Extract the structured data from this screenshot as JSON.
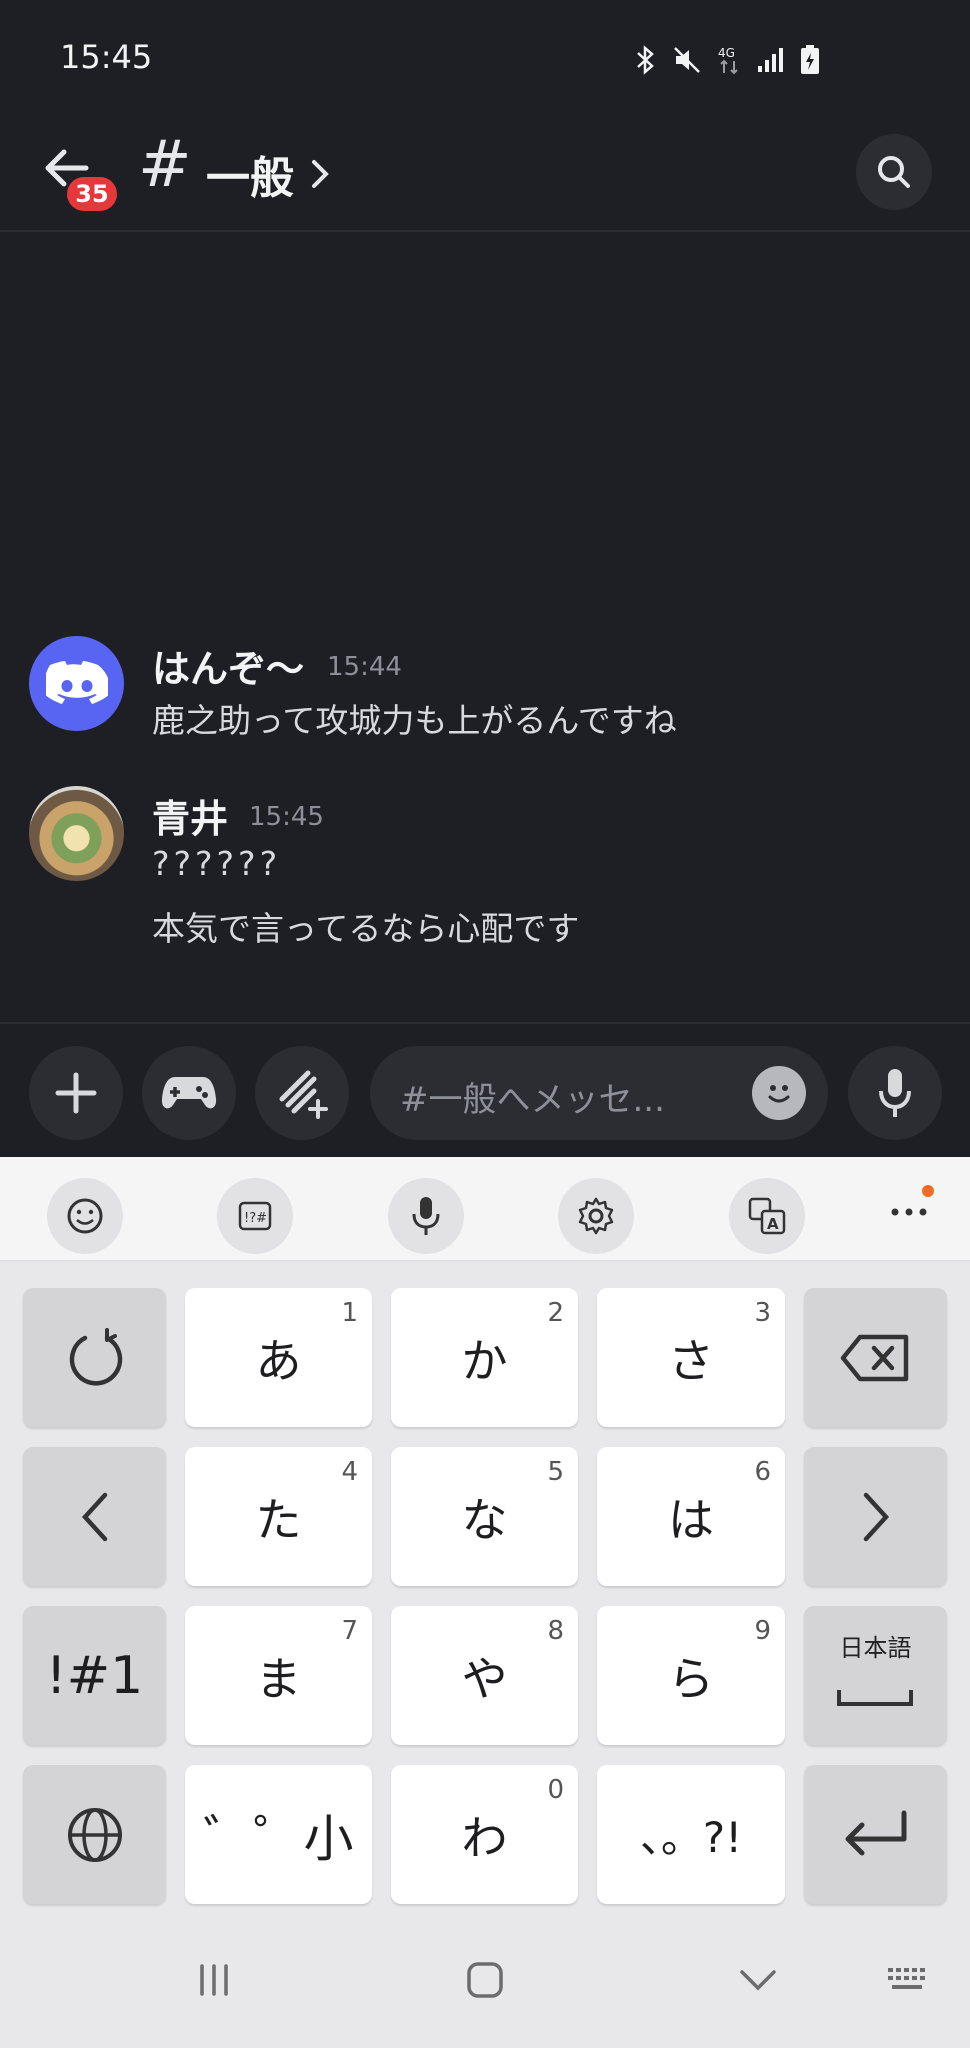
{
  "status_bar": {
    "time": "15:45",
    "icons": [
      "bluetooth-icon",
      "mute-icon",
      "4g-icon",
      "signal-icon",
      "battery-icon"
    ]
  },
  "header": {
    "unread_badge": "35",
    "hash": "#",
    "channel_name": "一般",
    "chevron": "›"
  },
  "messages": [
    {
      "author": "はんぞ〜",
      "time": "15:44",
      "lines": [
        "鹿之助って攻城力も上がるんですね"
      ],
      "avatar": "discord-logo"
    },
    {
      "author": "青井",
      "time": "15:45",
      "lines": [
        "??????",
        "本気で言ってるなら心配です"
      ],
      "avatar": "food-photo"
    }
  ],
  "composer": {
    "placeholder": "#一般へメッセ..."
  },
  "keyboard": {
    "toolbar_icons": [
      "emoji-icon",
      "symbols-icon",
      "voice-input-icon",
      "settings-icon",
      "translate-icon",
      "more-icon"
    ],
    "rows": [
      [
        {
          "label": "↺",
          "num": ""
        },
        {
          "label": "あ",
          "num": "1"
        },
        {
          "label": "か",
          "num": "2"
        },
        {
          "label": "さ",
          "num": "3"
        },
        {
          "label": "⌫",
          "num": ""
        }
      ],
      [
        {
          "label": "<",
          "num": ""
        },
        {
          "label": "た",
          "num": "4"
        },
        {
          "label": "な",
          "num": "5"
        },
        {
          "label": "は",
          "num": "6"
        },
        {
          "label": ">",
          "num": ""
        }
      ],
      [
        {
          "label": "!#1",
          "num": ""
        },
        {
          "label": "ま",
          "num": "7"
        },
        {
          "label": "や",
          "num": "8"
        },
        {
          "label": "ら",
          "num": "9"
        },
        {
          "label": "日本語",
          "num": ""
        }
      ],
      [
        {
          "label": "🌐",
          "num": ""
        },
        {
          "label": "゛゜小",
          "num": ""
        },
        {
          "label": "わ",
          "num": "0"
        },
        {
          "label": "、。?!",
          "num": ""
        },
        {
          "label": "↵",
          "num": ""
        }
      ]
    ]
  },
  "colors": {
    "background": "#1e1f24",
    "badge": "#e5383b",
    "discord_blue": "#5865f2",
    "accent_dot": "#f36c21"
  }
}
